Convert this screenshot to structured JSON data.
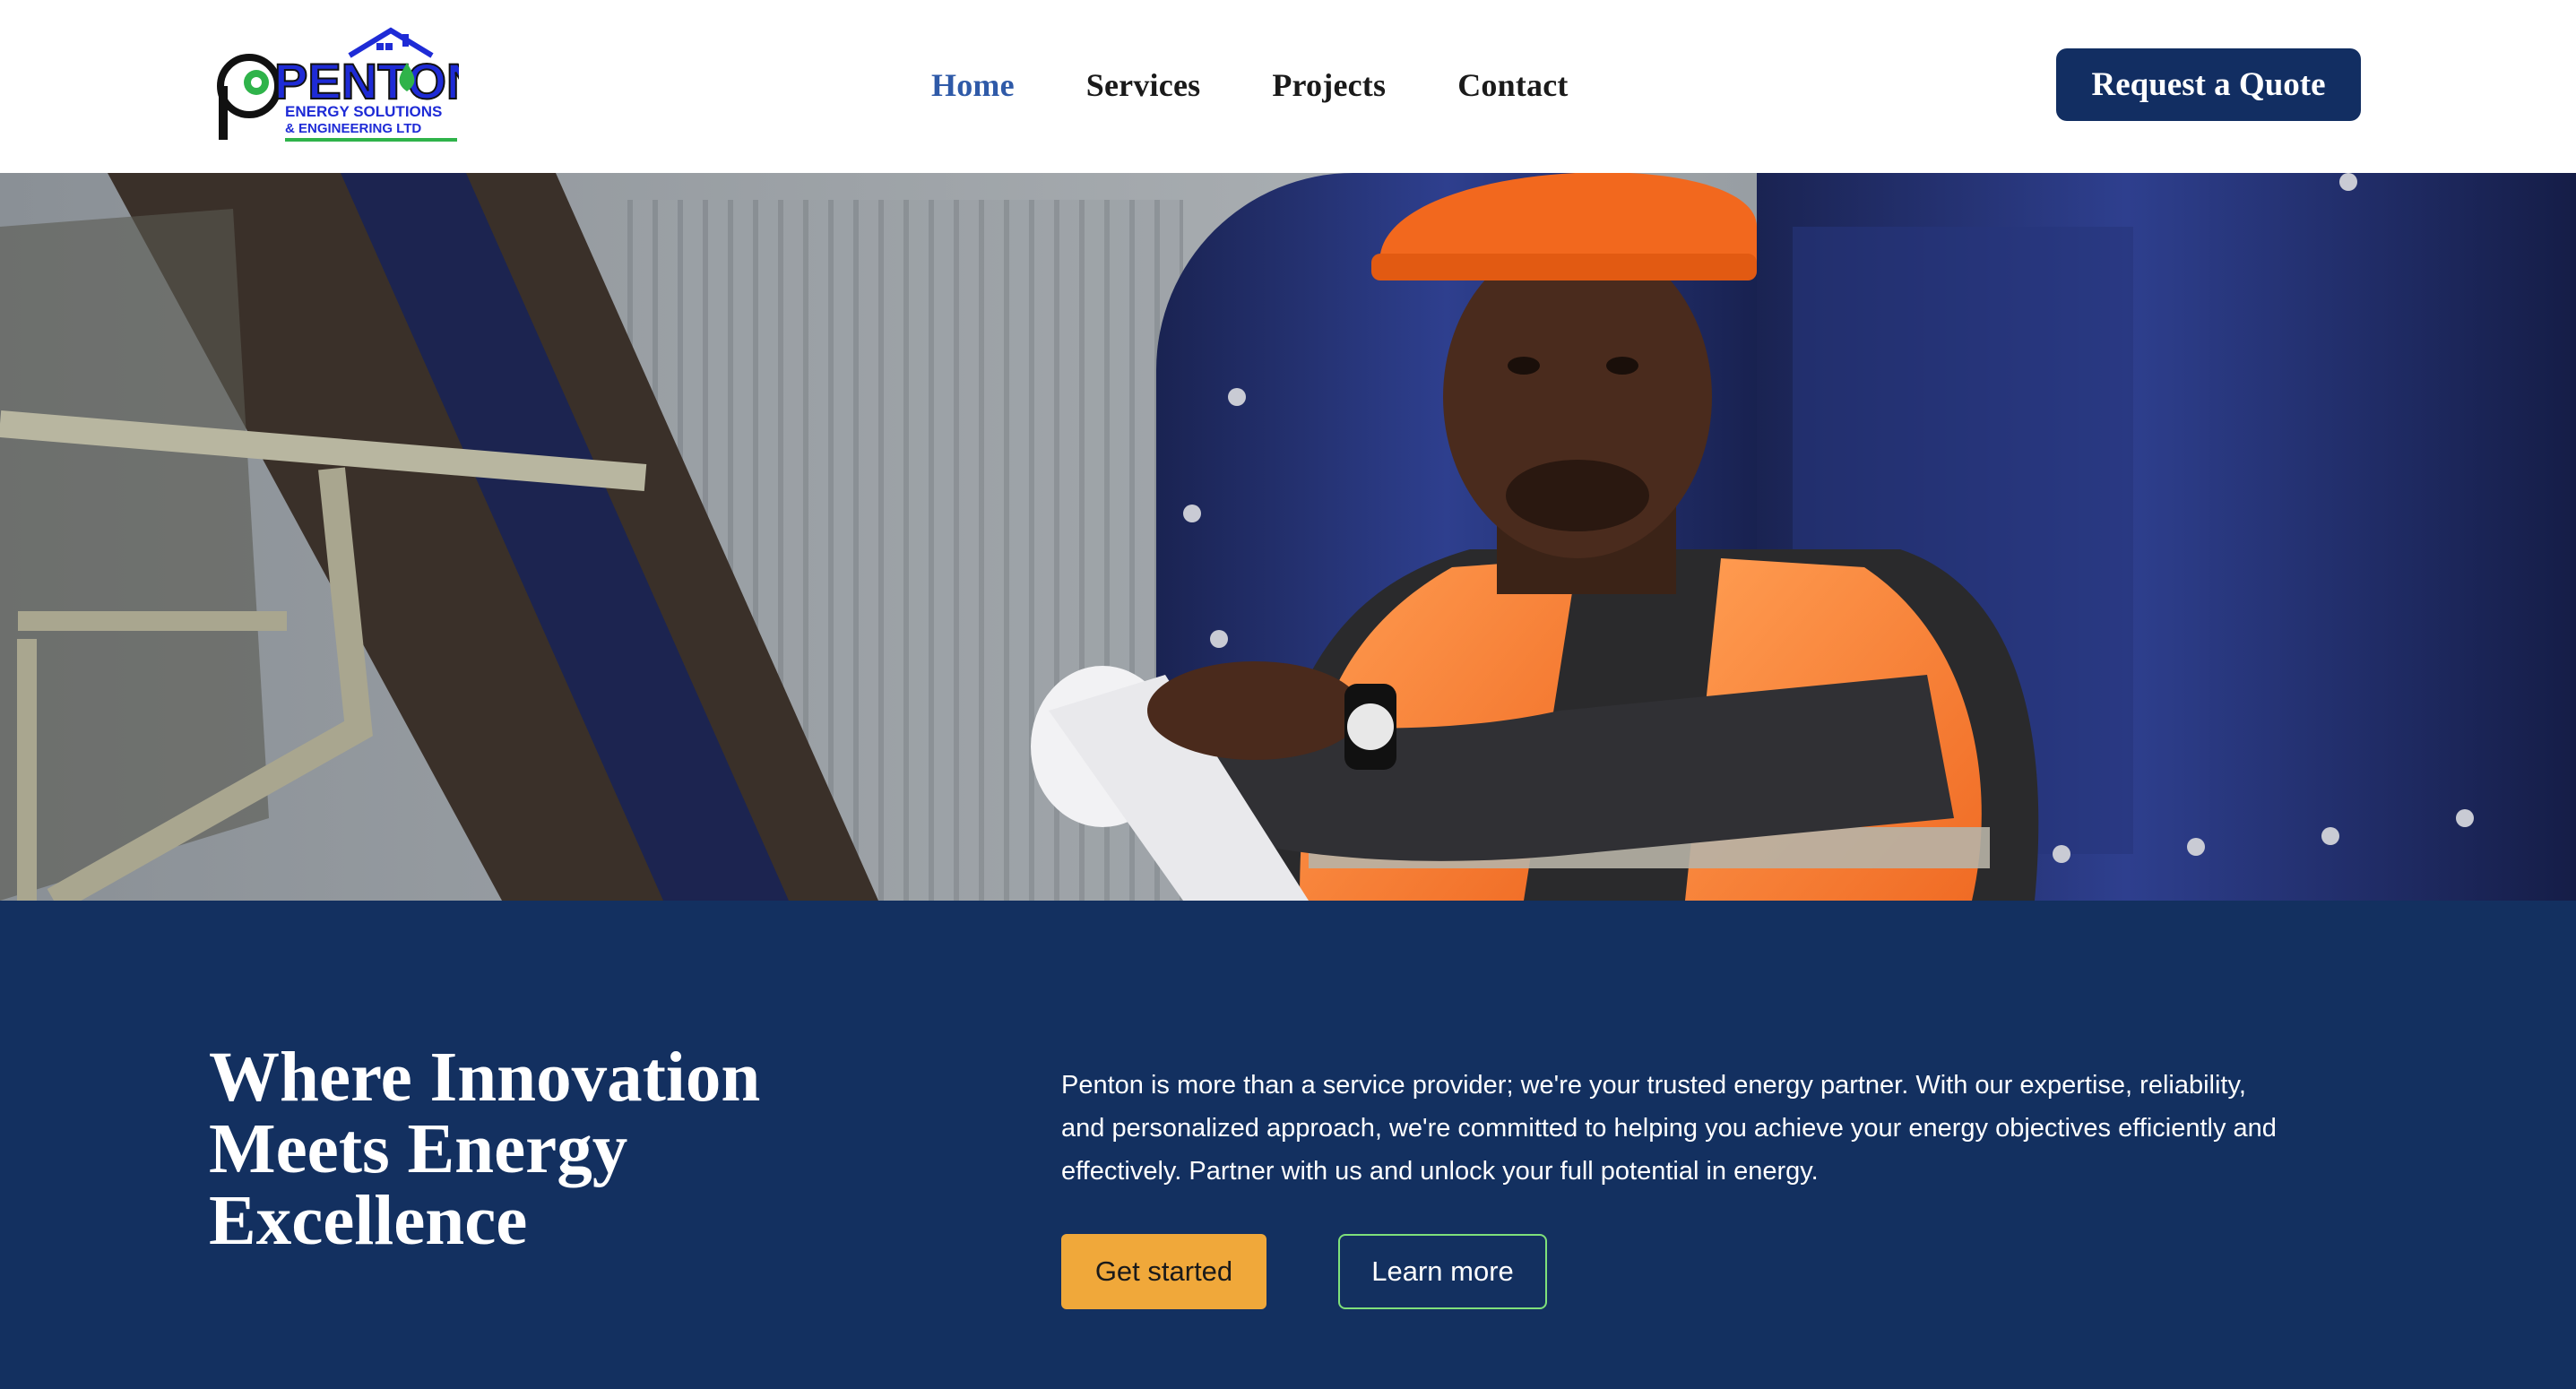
{
  "brand": {
    "logo_wordmark": "PENTON",
    "logo_line1": "ENERGY SOLUTIONS",
    "logo_line2": "& ENGINEERING LTD"
  },
  "nav": {
    "items": [
      {
        "label": "Home",
        "active": true
      },
      {
        "label": "Services",
        "active": false
      },
      {
        "label": "Projects",
        "active": false
      },
      {
        "label": "Contact",
        "active": false
      }
    ],
    "cta_label": "Request a Quote"
  },
  "hero": {
    "image_icon": "hero-photo"
  },
  "intro": {
    "headline": "Where Innovation Meets Energy Excellence",
    "paragraph": "Penton is more than a service provider; we're your trusted energy partner. With our expertise, reliability, and personalized approach, we're committed to helping you achieve your energy objectives efficiently and effectively. Partner with us and unlock your full potential in energy.",
    "primary_button": "Get started",
    "secondary_button": "Learn more"
  },
  "colors": {
    "navy": "#133060",
    "header_button": "#122e62",
    "active_link": "#2f5aa8",
    "accent_orange": "#f0a83a",
    "accent_green": "#7fe07a",
    "logo_blue": "#1e2bd6",
    "logo_green": "#2fb34a"
  }
}
